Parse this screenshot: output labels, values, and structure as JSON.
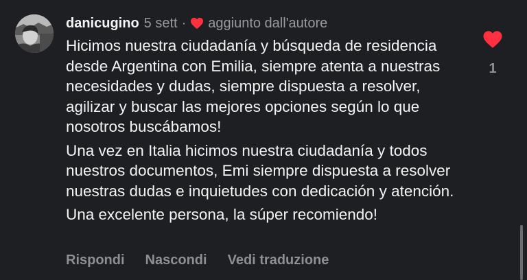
{
  "comment": {
    "username": "danicugino",
    "time": "5 sett",
    "separator": "·",
    "liked_by_author": "aggiunto dall'autore",
    "paragraphs": [
      "Hicimos nuestra ciudadanía y búsqueda de residencia desde Argentina con Emilia, siempre atenta a nuestras necesidades y dudas, siempre dispuesta a resolver, agilizar y buscar las mejores opciones según lo que nosotros buscábamos!",
      "Una vez en Italia hicimos nuestra ciudadanía y todos nuestros documentos, Emi siempre dispuesta a resolver nuestras dudas e inquietudes con dedicación y atención.",
      "Una excelente persona, la súper recomiendo!"
    ]
  },
  "actions": {
    "reply": "Rispondi",
    "hide": "Nascondi",
    "translate": "Vedi traduzione"
  },
  "like": {
    "icon": "heart-filled-icon",
    "count": "1",
    "color": "#ff3040"
  },
  "colors": {
    "background": "#1e1f22",
    "text": "#f4f4f4",
    "muted": "#9a9a9e",
    "heart": "#ff3040"
  }
}
